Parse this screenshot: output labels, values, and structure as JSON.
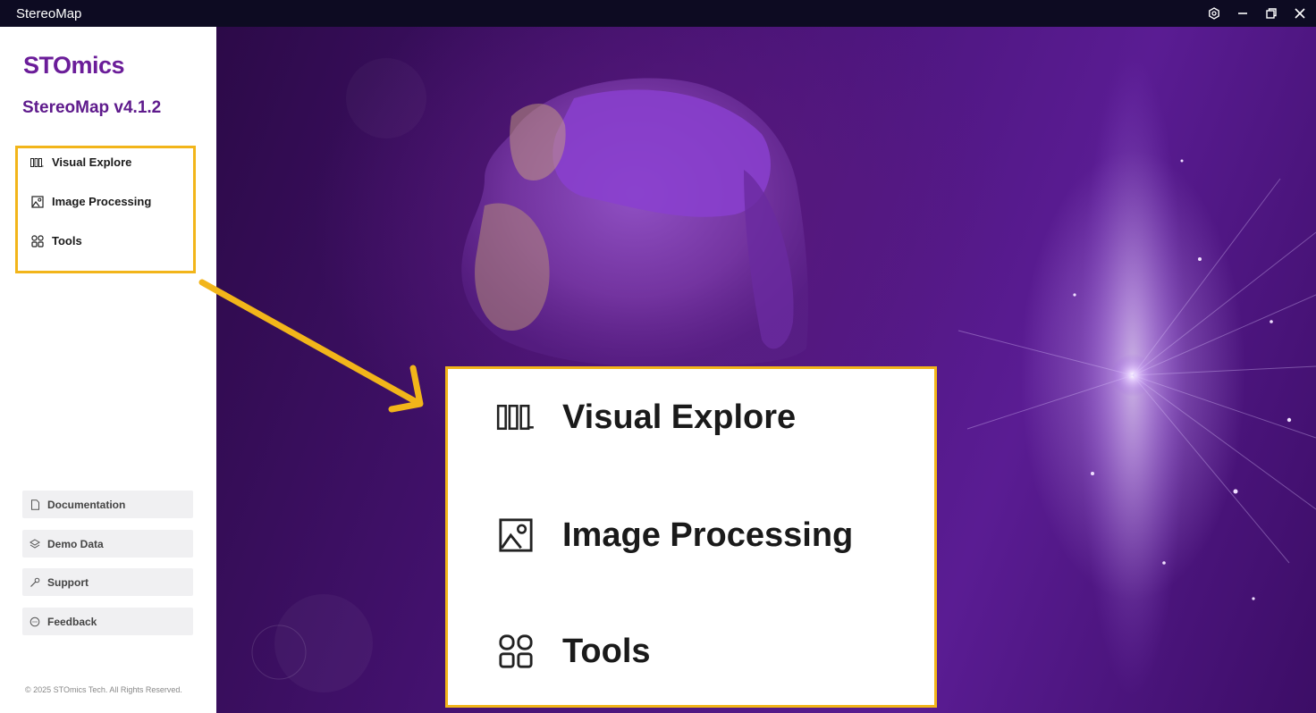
{
  "window": {
    "title": "StereoMap"
  },
  "sidebar": {
    "brand": "STOmics",
    "version": "StereoMap v4.1.2",
    "nav": [
      {
        "label": "Visual Explore",
        "icon": "visual-explore-icon"
      },
      {
        "label": "Image Processing",
        "icon": "image-icon"
      },
      {
        "label": "Tools",
        "icon": "grid-icon"
      }
    ],
    "bottom": [
      {
        "label": "Documentation",
        "icon": "document-icon"
      },
      {
        "label": "Demo Data",
        "icon": "layers-icon"
      },
      {
        "label": "Support",
        "icon": "wrench-icon"
      },
      {
        "label": "Feedback",
        "icon": "chat-icon"
      }
    ],
    "copyright": "© 2025 STOmics Tech. All Rights Reserved."
  },
  "callout": {
    "items": [
      {
        "label": "Visual Explore"
      },
      {
        "label": "Image Processing"
      },
      {
        "label": "Tools"
      }
    ]
  },
  "colors": {
    "brand": "#6b1d99",
    "highlight": "#f2b51a",
    "titlebar": "#0d0b22"
  }
}
